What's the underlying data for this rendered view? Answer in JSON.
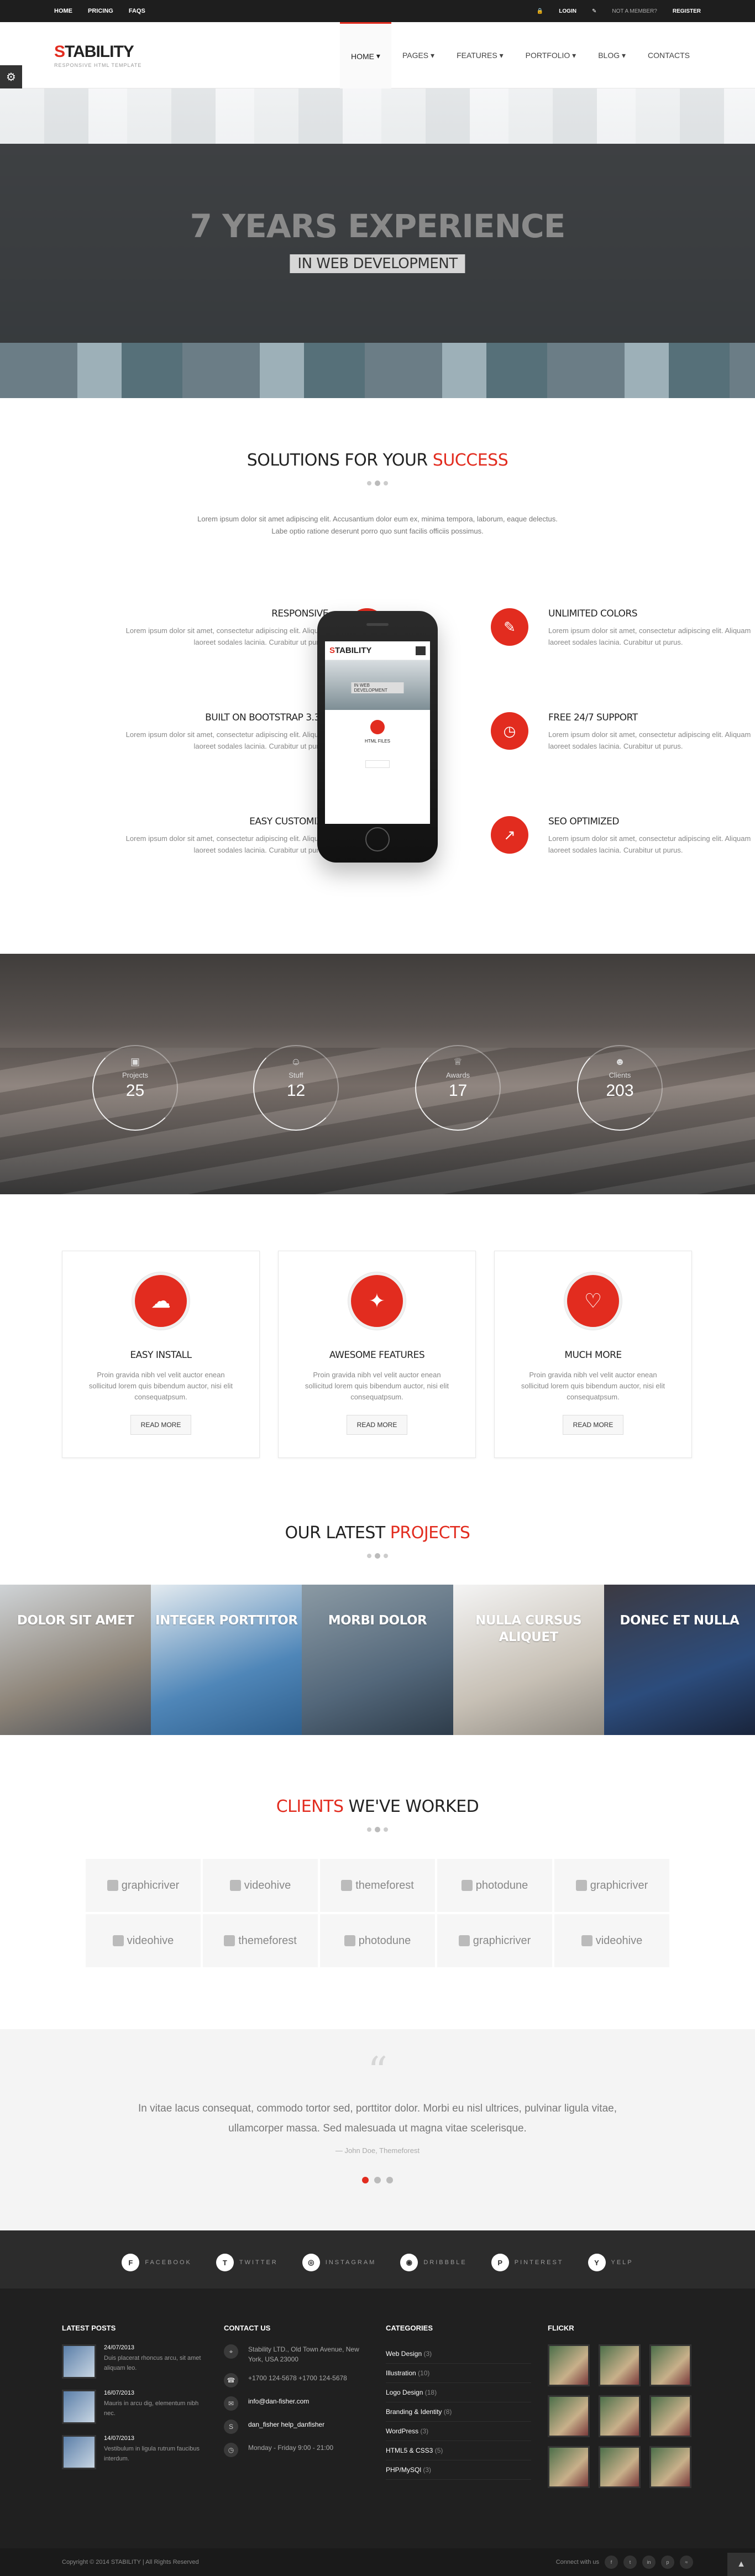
{
  "topbar": {
    "left": [
      "Home",
      "Pricing",
      "FAQS"
    ],
    "login": "Login",
    "register_prompt": "Not a member?",
    "register": "Register"
  },
  "header": {
    "logo_a": "S",
    "logo_b": "TABILITY",
    "tagline": "Responsive HTML Template",
    "nav": [
      "Home",
      "Pages",
      "Features",
      "Portfolio",
      "Blog",
      "Contacts"
    ]
  },
  "hero": {
    "title": "7 Years Experience",
    "subtitle": "in web development"
  },
  "solutions": {
    "title_a": "Solutions for your ",
    "title_b": "success",
    "intro_1": "Lorem ipsum dolor sit amet adipiscing elit. Accusantium dolor eum ex, minima tempora, laborum, eaque delectus.",
    "intro_2": "Labe optio ratione deserunt porro quo sunt facilis officiis possimus.",
    "features": [
      {
        "title": "Responsive",
        "text": "Lorem ipsum dolor sit amet, consectetur adipiscing elit. Aliquam laoreet sodales lacinia. Curabitur ut purus.",
        "icon": "laptop-icon"
      },
      {
        "title": "Built on bootstrap 3.3.1",
        "text": "Lorem ipsum dolor sit amet, consectetur adipiscing elit. Aliquam laoreet sodales lacinia. Curabitur ut purus.",
        "icon": "briefcase-icon"
      },
      {
        "title": "Easy customize",
        "text": "Lorem ipsum dolor sit amet, consectetur adipiscing elit. Aliquam laoreet sodales lacinia. Curabitur ut purus.",
        "icon": "cogs-icon"
      },
      {
        "title": "Unlimited colors",
        "text": "Lorem ipsum dolor sit amet, consectetur adipiscing elit. Aliquam laoreet sodales lacinia. Curabitur ut purus.",
        "icon": "brush-icon"
      },
      {
        "title": "Free 24/7 support",
        "text": "Lorem ipsum dolor sit amet, consectetur adipiscing elit. Aliquam laoreet sodales lacinia. Curabitur ut purus.",
        "icon": "clock-icon"
      },
      {
        "title": "SEO optimized",
        "text": "Lorem ipsum dolor sit amet, consectetur adipiscing elit. Aliquam laoreet sodales lacinia. Curabitur ut purus.",
        "icon": "chart-line-icon"
      }
    ],
    "phone": {
      "logo_a": "S",
      "logo_b": "TABILITY",
      "hero_text": "IN WEB DEVELOPMENT",
      "feature": "HTML FILES"
    }
  },
  "counters": [
    {
      "label": "Projects",
      "value": "25",
      "icon": "briefcase-icon"
    },
    {
      "label": "Stuff",
      "value": "12",
      "icon": "users-icon"
    },
    {
      "label": "Awards",
      "value": "17",
      "icon": "trophy-icon"
    },
    {
      "label": "Clients",
      "value": "203",
      "icon": "user-icon"
    }
  ],
  "services": [
    {
      "title": "Easy install",
      "text": "Proin gravida nibh vel velit auctor enean sollicitud lorem quis bibendum auctor, nisi elit consequatpsum.",
      "button": "Read more",
      "icon": "cloud-download-icon"
    },
    {
      "title": "Awesome features",
      "text": "Proin gravida nibh vel velit auctor enean sollicitud lorem quis bibendum auctor, nisi elit consequatpsum.",
      "button": "Read more",
      "icon": "magic-wand-icon"
    },
    {
      "title": "Much more",
      "text": "Proin gravida nibh vel velit auctor enean sollicitud lorem quis bibendum auctor, nisi elit consequatpsum.",
      "button": "Read more",
      "icon": "heart-icon"
    }
  ],
  "projects": {
    "title_a": "Our latest ",
    "title_b": "projects",
    "items": [
      "Dolor sit amet",
      "Integer porttitor",
      "Morbi dolor",
      "Nulla cursus aliquet",
      "Donec et nulla"
    ]
  },
  "clients": {
    "title_a": "Clients",
    "title_b": " we've worked",
    "logos": [
      "graphicriver",
      "videohive",
      "themeforest",
      "photodune",
      "graphicriver",
      "videohive",
      "themeforest",
      "photodune",
      "graphicriver",
      "videohive"
    ]
  },
  "testimonial": {
    "quote": "In vitae lacus consequat, commodo tortor sed, porttitor dolor. Morbi eu nisl ultrices, pulvinar ligula vitae, ullamcorper massa. Sed malesuada ut magna vitae scelerisque.",
    "author": "— John Doe, Themeforest"
  },
  "social": [
    {
      "label": "Facebook",
      "glyph": "f"
    },
    {
      "label": "Twitter",
      "glyph": "t"
    },
    {
      "label": "Instagram",
      "glyph": "◎"
    },
    {
      "label": "Dribbble",
      "glyph": "◉"
    },
    {
      "label": "Pinterest",
      "glyph": "p"
    },
    {
      "label": "Yelp",
      "glyph": "y"
    }
  ],
  "footer": {
    "headings": [
      "Latest Posts",
      "Contact Us",
      "Categories",
      "Flickr"
    ],
    "posts": [
      {
        "date": "24/07/2013",
        "text": "Duis placerat rhoncus arcu, sit amet aliquam leo."
      },
      {
        "date": "16/07/2013",
        "text": "Mauris in arcu dig, elementum nibh nec."
      },
      {
        "date": "14/07/2013",
        "text": "Vestibulum in ligula rutrum faucibus interdum."
      }
    ],
    "contact": {
      "address": "Stability LTD., Old Town Avenue, New York, USA 23000",
      "phone": "+1700 124-5678 +1700 124-5678",
      "email": "info@dan-fisher.com",
      "skype": "dan_fisher help_danfisher",
      "hours": "Monday - Friday 9:00 - 21:00"
    },
    "categories": [
      {
        "name": "Web Design",
        "count": "(3)"
      },
      {
        "name": "Illustration",
        "count": "(10)"
      },
      {
        "name": "Logo Design",
        "count": "(18)"
      },
      {
        "name": "Branding & Identity",
        "count": "(8)"
      },
      {
        "name": "WordPress",
        "count": "(3)"
      },
      {
        "name": "HTML5 & CSS3",
        "count": "(5)"
      },
      {
        "name": "PHP/MySQl",
        "count": "(3)"
      }
    ]
  },
  "bottombar": {
    "copyright": "Copyright © 2014 STABILITY | All Rights Reserved",
    "connect": "Connect with us"
  },
  "colors": {
    "accent": "#e22c1f",
    "dark": "#202020"
  }
}
